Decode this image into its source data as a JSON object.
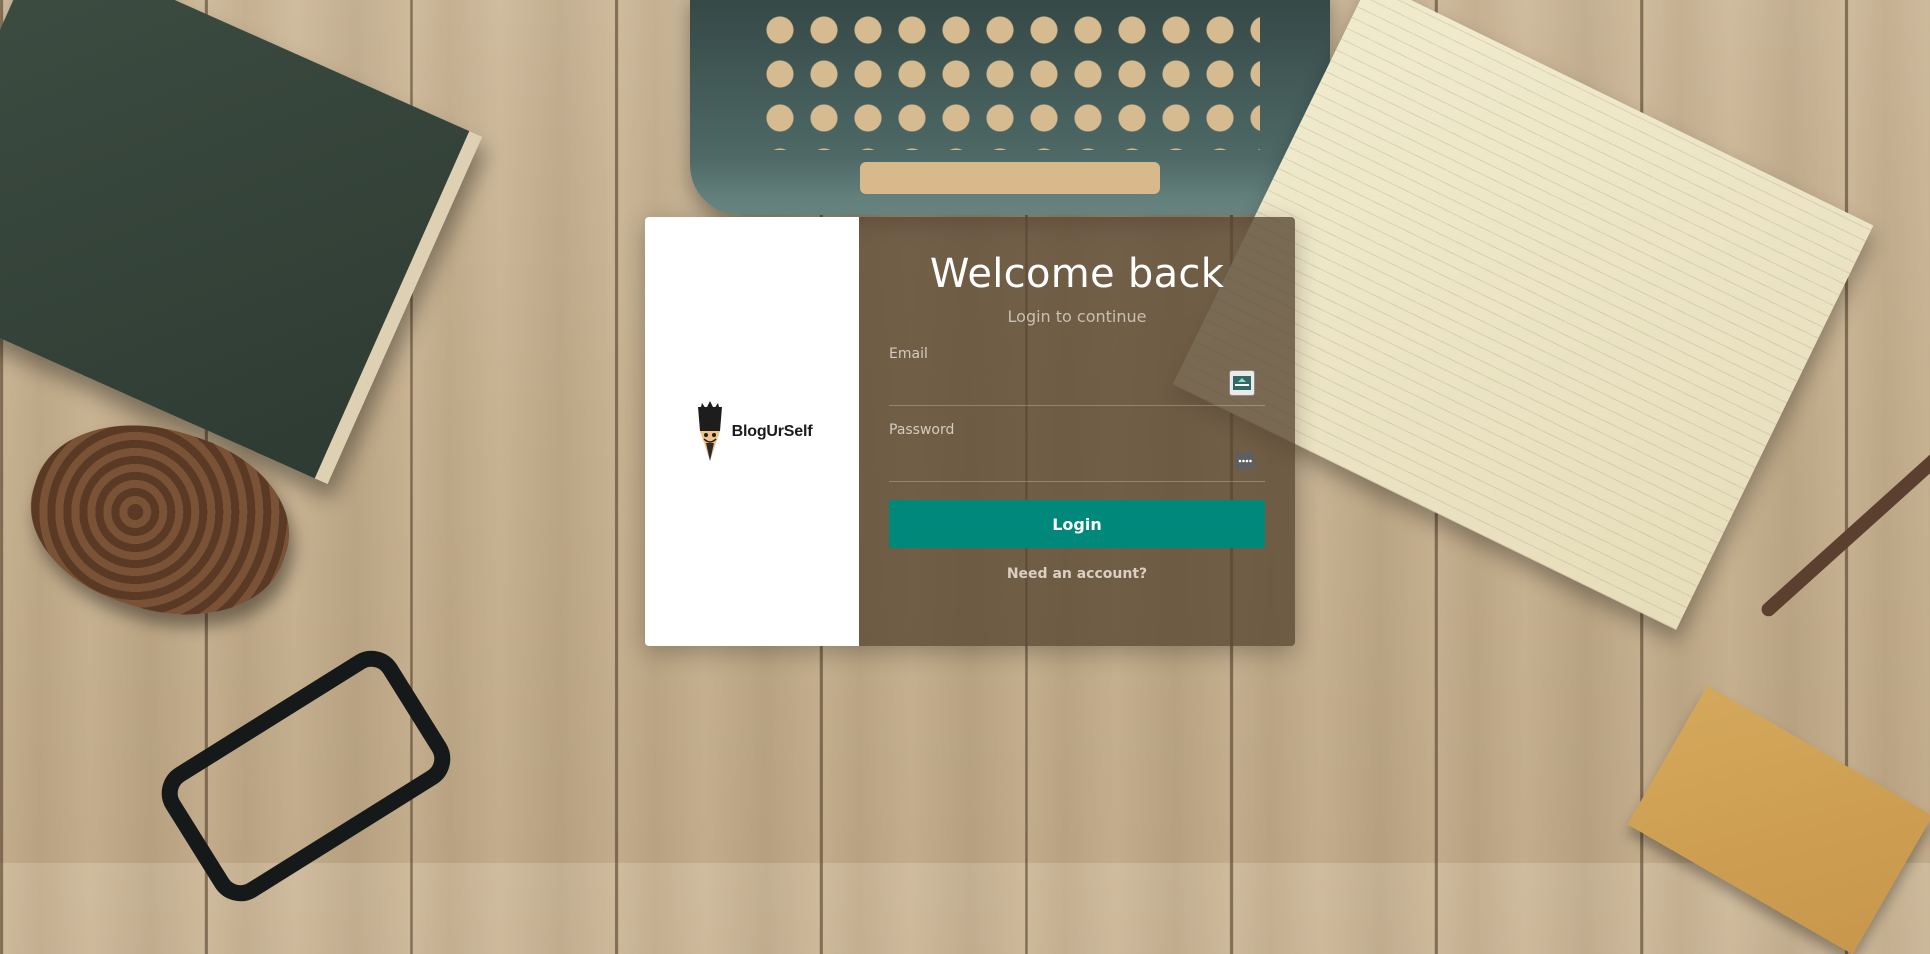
{
  "brand": {
    "name": "BlogUrSelf"
  },
  "login": {
    "title": "Welcome back",
    "subtitle": "Login to continue",
    "email": {
      "label": "Email",
      "value": "",
      "placeholder": ""
    },
    "password": {
      "label": "Password",
      "value": "",
      "placeholder": ""
    },
    "submit_label": "Login",
    "signup_link": "Need an account?"
  },
  "colors": {
    "accent": "#00897b",
    "form_panel": "#58463280",
    "brand_panel": "#ffffff"
  },
  "icons": {
    "email_field": "email-autofill-icon",
    "password_field": "password-autofill-icon",
    "logo": "pencil-mascot-icon"
  }
}
